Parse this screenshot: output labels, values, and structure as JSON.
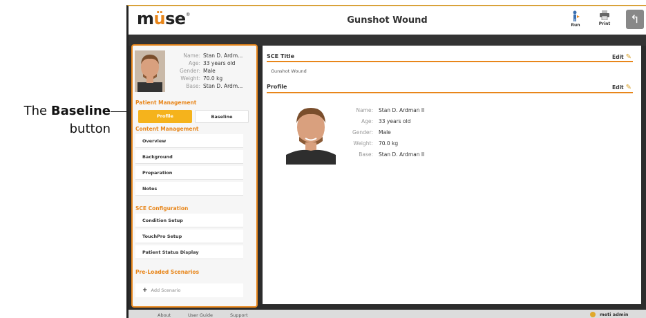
{
  "annotation": {
    "the": "The",
    "bold": "Baseline",
    "rest": "button"
  },
  "app": {
    "logo": {
      "m": "m",
      "u": "ü",
      "se": "se"
    },
    "title": "Gunshot Wound",
    "run_label": "Run",
    "print_label": "Print"
  },
  "sidebar": {
    "patient": {
      "name_label": "Name:",
      "name": "Stan D. Ardm...",
      "age_label": "Age:",
      "age": "33 years old",
      "gender_label": "Gender:",
      "gender": "Male",
      "weight_label": "Weight:",
      "weight": "70.0 kg",
      "base_label": "Base:",
      "base": "Stan D. Ardm..."
    },
    "patient_management": "Patient Management",
    "profile_tab": "Profile",
    "baseline_tab": "Baseline",
    "content_management": "Content Management",
    "content_items": [
      "Overview",
      "Background",
      "Preparation",
      "Notes"
    ],
    "sce_configuration": "SCE Configuration",
    "config_items": [
      "Condition Setup",
      "TouchPro Setup",
      "Patient Status Display"
    ],
    "preloaded": "Pre-Loaded Scenarios",
    "add_scenario": "Add Scenario"
  },
  "main": {
    "sce_title_heading": "SCE Title",
    "edit_label": "Edit",
    "sce_title_value": "Gunshot Wound",
    "profile_heading": "Profile",
    "profile": {
      "name_label": "Name:",
      "name": "Stan D. Ardman II",
      "age_label": "Age:",
      "age": "33 years old",
      "gender_label": "Gender:",
      "gender": "Male",
      "weight_label": "Weight:",
      "weight": "70.0 kg",
      "base_label": "Base:",
      "base": "Stan D. Ardman II"
    }
  },
  "footer": {
    "about": "About",
    "user_guide": "User Guide",
    "support": "Support",
    "user": "meti admin"
  },
  "colors": {
    "accent": "#e8861a",
    "active_tab": "#f5b31c",
    "dark_bar": "#2c2c2c"
  }
}
